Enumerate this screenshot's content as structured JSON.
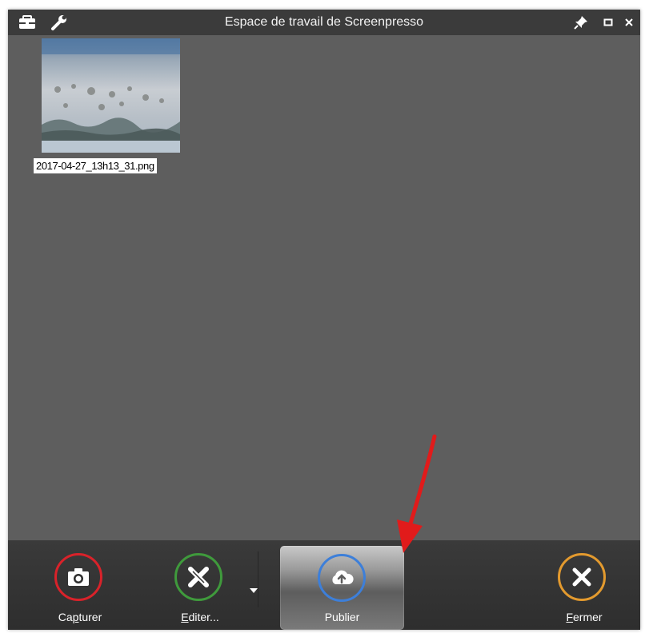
{
  "window": {
    "title": "Espace de travail de Screenpresso",
    "icons": [
      "toolbox-icon",
      "wrench-icon",
      "pin-icon",
      "restore-icon",
      "close-icon"
    ]
  },
  "workspace": {
    "items": [
      {
        "filename": "2017-04-27_13h13_31.png"
      }
    ]
  },
  "toolbar": {
    "capture": {
      "label_pre": "Ca",
      "label_ul": "p",
      "label_post": "turer",
      "icon": "camera-icon",
      "color": "#d9222a"
    },
    "edit": {
      "label_pre": "",
      "label_ul": "E",
      "label_post": "diter...",
      "icon": "edit-tools-icon",
      "color": "#3f9a3c"
    },
    "publish": {
      "label_pre": "",
      "label_ul": "",
      "label_post": "Publier",
      "icon": "cloud-upload-icon",
      "color": "#3d7fd9"
    },
    "close": {
      "label_pre": "",
      "label_ul": "F",
      "label_post": "ermer",
      "icon": "close-x-icon",
      "color": "#e39a2e"
    }
  },
  "annotation": {
    "color": "#e11b1b"
  }
}
